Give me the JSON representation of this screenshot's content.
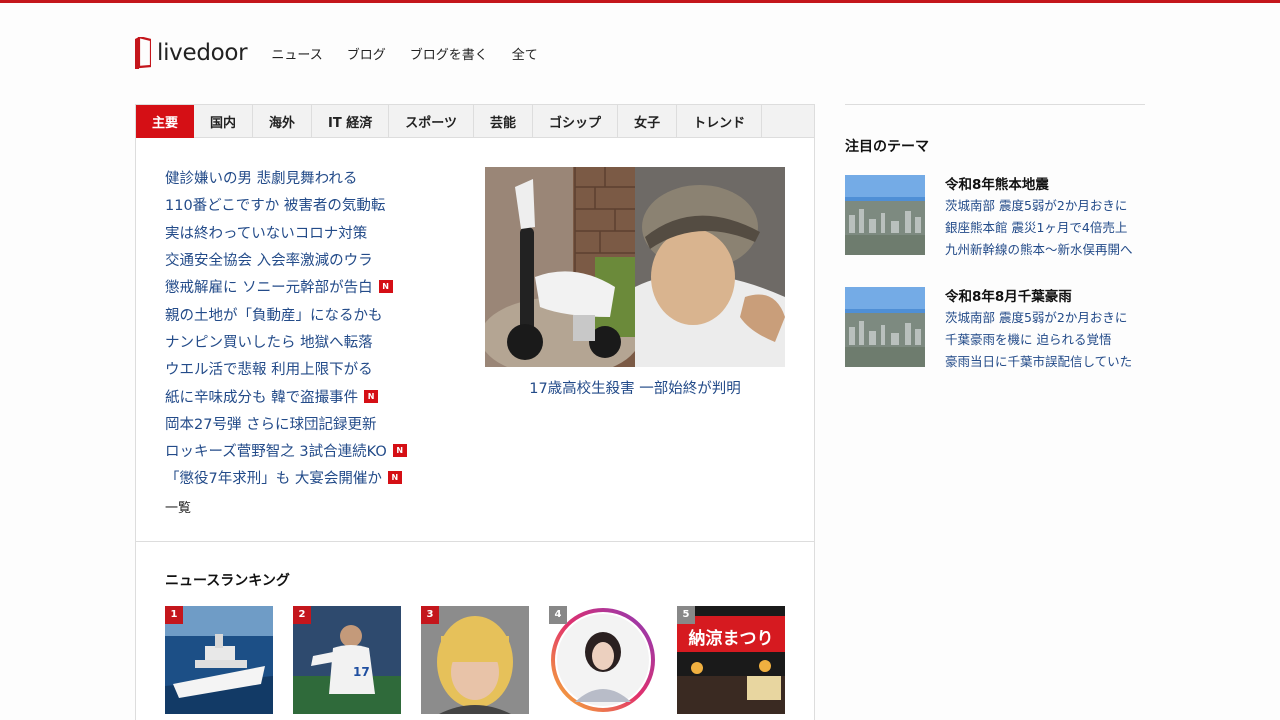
{
  "header": {
    "logo_text": "livedoor",
    "nav": [
      "ニュース",
      "ブログ",
      "ブログを書く",
      "全て"
    ]
  },
  "tabs": [
    "主要",
    "国内",
    "海外",
    "IT 経済",
    "スポーツ",
    "芸能",
    "ゴシップ",
    "女子",
    "トレンド"
  ],
  "active_tab": "主要",
  "news": [
    {
      "title": "健診嫌いの男 悲劇見舞われる",
      "is_new": false
    },
    {
      "title": "110番どこですか 被害者の気動転",
      "is_new": false
    },
    {
      "title": "実は終わっていないコロナ対策",
      "is_new": false
    },
    {
      "title": "交通安全協会 入会率激減のウラ",
      "is_new": false
    },
    {
      "title": "懲戒解雇に ソニー元幹部が告白",
      "is_new": true
    },
    {
      "title": "親の土地が「負動産」になるかも",
      "is_new": false
    },
    {
      "title": "ナンピン買いしたら 地獄へ転落",
      "is_new": false
    },
    {
      "title": "ウエル活で悲報 利用上限下がる",
      "is_new": false
    },
    {
      "title": "紙に辛味成分も 韓で盗撮事件",
      "is_new": true
    },
    {
      "title": "岡本27号弾 さらに球団記録更新",
      "is_new": false
    },
    {
      "title": "ロッキーズ菅野智之 3試合連続KO",
      "is_new": true
    },
    {
      "title": "「懲役7年求刑」も 大宴会開催か",
      "is_new": true
    }
  ],
  "new_badge": "N",
  "more_label": "一覧",
  "feature": {
    "caption": "17歳高校生殺害 一部始終が判明"
  },
  "ranking": {
    "title": "ニュースランキング",
    "items": [
      {
        "rank": "1",
        "color": "#c4161c"
      },
      {
        "rank": "2",
        "color": "#c4161c"
      },
      {
        "rank": "3",
        "color": "#c4161c"
      },
      {
        "rank": "4",
        "color": "#888888"
      },
      {
        "rank": "5",
        "color": "#888888"
      }
    ],
    "banner_text": "納涼まつり"
  },
  "sidebar": {
    "title": "注目のテーマ",
    "themes": [
      {
        "name": "令和8年熊本地震",
        "links": [
          "茨城南部 震度5弱が2か月おきに",
          "銀座熊本館 震災1ヶ月で4倍売上",
          "九州新幹線の熊本〜新水俣再開へ"
        ]
      },
      {
        "name": "令和8年8月千葉豪雨",
        "links": [
          "茨城南部 震度5弱が2か月おきに",
          "千葉豪雨を機に 迫られる覚悟",
          "豪雨当日に千葉市誤配信していた"
        ]
      }
    ]
  },
  "colors": {
    "accent": "#d50f15",
    "link": "#234b89"
  }
}
